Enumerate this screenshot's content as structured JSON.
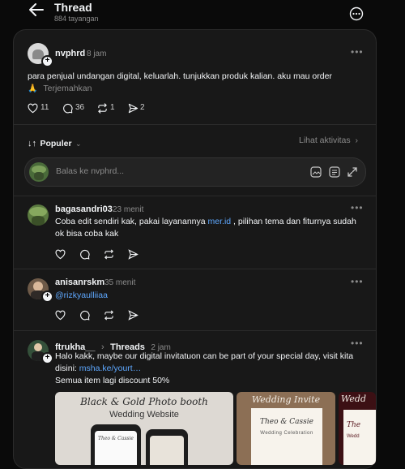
{
  "header": {
    "title": "Thread",
    "views": "884 tayangan"
  },
  "post": {
    "author": "nvphrd",
    "time": "8 jam",
    "text": "para penjual undangan digital, keluarlah. tunjukkan produk kalian. aku mau order",
    "emoji": "🙏",
    "translate": "Terjemahkan",
    "likes": "11",
    "comments": "36",
    "reposts": "1",
    "shares": "2"
  },
  "sort": {
    "label": "Populer",
    "activity": "Lihat aktivitas"
  },
  "reply_box": {
    "placeholder": "Balas ke nvphrd..."
  },
  "replies": [
    {
      "author": "bagasandri03",
      "time": "23 menit",
      "text_before": "Coba edit sendiri kak, pakai layanannya ",
      "link": "mer.id",
      "text_after": " , pilihan tema dan fiturnya sudah ok bisa coba kak"
    },
    {
      "author": "anisanrskm",
      "time": "35 menit",
      "mention": "@rizkyaulliiaa"
    },
    {
      "author": "ftrukha__",
      "via": "Threads",
      "time": "2 jam",
      "text": "Halo kakk, maybe our digital invitatuon can be part of your special day, visit kita disini: ",
      "link": "msha.ke/yourt…",
      "text2": "Semua item lagi discount 50%",
      "images": [
        {
          "title": "Black & Gold Photo booth",
          "subtitle": "Wedding Website",
          "card": "Theo & Cassie"
        },
        {
          "title": "Wedding Invite",
          "names": "Theo & Cassie",
          "caption": "Wedding Celebration"
        },
        {
          "title": "Wedd",
          "names": "The",
          "caption": "Wedd"
        }
      ]
    }
  ],
  "colors": {
    "background": "#0a0a0a",
    "panel": "#181818",
    "link": "#5ea8ff",
    "muted": "#8b8b8b"
  }
}
